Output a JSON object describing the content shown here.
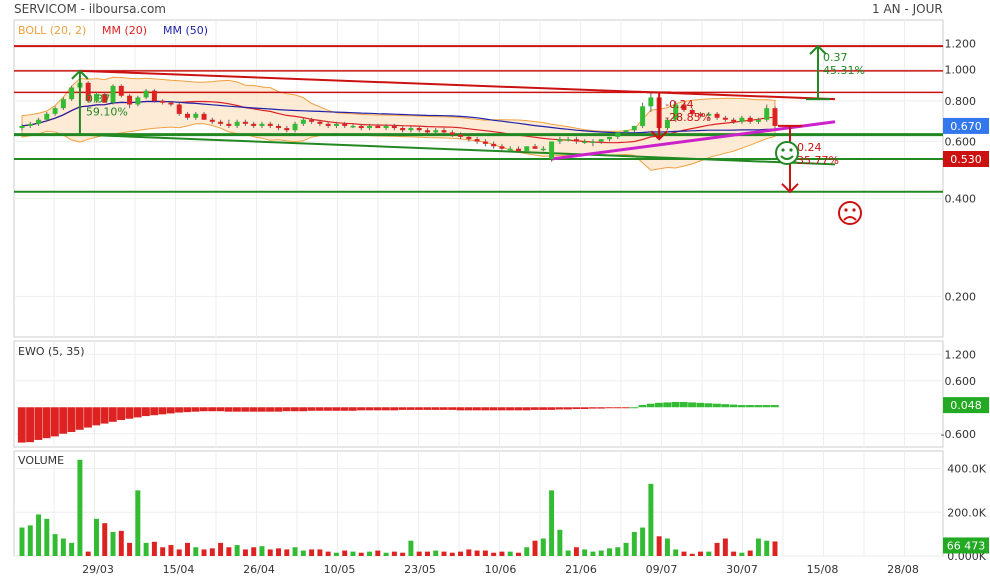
{
  "header": {
    "title": "SERVICOM - ilboursa.com",
    "period": "1 AN - JOUR"
  },
  "legend": {
    "boll": "BOLL (20, 2)",
    "mm20": "MM (20)",
    "mm50": "MM (50)",
    "ewo": "EWO (5, 35)",
    "volume": "VOLUME"
  },
  "colors": {
    "up": "#33bb33",
    "down": "#dd2222",
    "boll": "#f0a040",
    "mm20": "#dd2222",
    "mm50": "#2222aa",
    "trend_up": "#228822",
    "support_magenta": "#cc22cc",
    "price_tag": "#3377ee",
    "ref_tag": "#cc1111",
    "ewo_tag": "#22aa22"
  },
  "icons": {
    "happy": "smiley-happy-icon",
    "sad": "smiley-sad-icon"
  },
  "chart_data": [
    {
      "type": "candlestick",
      "title": "SERVICOM",
      "x_ticks": [
        "29/03",
        "15/04",
        "26/04",
        "10/05",
        "23/05",
        "10/06",
        "21/06",
        "09/07",
        "30/07",
        "15/08",
        "28/08"
      ],
      "y_ticks": [
        "1.200",
        "1.000",
        "0.800",
        "0.600",
        "0.400",
        "0.200"
      ],
      "y_scale": "log",
      "ylim": [
        0.15,
        1.42
      ],
      "last_price_label": "0.670",
      "ref_label": "0.530",
      "horizontal_levels": [
        1.18,
        0.99,
        0.85,
        0.63,
        0.53,
        0.42
      ],
      "annotations": [
        {
          "value": "0.37",
          "pct": "59.10%"
        },
        {
          "value": "0.37",
          "pct": "45.31%"
        },
        {
          "value": "-0.24",
          "pct": "-28.85%"
        },
        {
          "value": "-0.24",
          "pct": "-35.77%"
        }
      ],
      "ohlc": [
        [
          0.66,
          0.68,
          0.65,
          0.67
        ],
        [
          0.67,
          0.69,
          0.66,
          0.68
        ],
        [
          0.68,
          0.71,
          0.67,
          0.7
        ],
        [
          0.7,
          0.74,
          0.69,
          0.73
        ],
        [
          0.73,
          0.77,
          0.72,
          0.76
        ],
        [
          0.76,
          0.82,
          0.75,
          0.81
        ],
        [
          0.81,
          0.89,
          0.8,
          0.88
        ],
        [
          0.88,
          0.99,
          0.63,
          0.91
        ],
        [
          0.91,
          0.92,
          0.79,
          0.8
        ],
        [
          0.8,
          0.85,
          0.79,
          0.84
        ],
        [
          0.84,
          0.85,
          0.79,
          0.79
        ],
        [
          0.79,
          0.9,
          0.78,
          0.89
        ],
        [
          0.89,
          0.9,
          0.82,
          0.83
        ],
        [
          0.83,
          0.84,
          0.76,
          0.78
        ],
        [
          0.78,
          0.83,
          0.77,
          0.82
        ],
        [
          0.82,
          0.87,
          0.81,
          0.86
        ],
        [
          0.86,
          0.87,
          0.79,
          0.8
        ],
        [
          0.8,
          0.81,
          0.78,
          0.79
        ],
        [
          0.79,
          0.8,
          0.77,
          0.78
        ],
        [
          0.78,
          0.79,
          0.72,
          0.73
        ],
        [
          0.73,
          0.74,
          0.7,
          0.71
        ],
        [
          0.71,
          0.74,
          0.7,
          0.73
        ],
        [
          0.73,
          0.74,
          0.7,
          0.7
        ],
        [
          0.7,
          0.71,
          0.68,
          0.69
        ],
        [
          0.69,
          0.7,
          0.67,
          0.68
        ],
        [
          0.68,
          0.7,
          0.66,
          0.67
        ],
        [
          0.67,
          0.7,
          0.66,
          0.69
        ],
        [
          0.69,
          0.7,
          0.67,
          0.68
        ],
        [
          0.68,
          0.69,
          0.66,
          0.67
        ],
        [
          0.67,
          0.69,
          0.66,
          0.68
        ],
        [
          0.68,
          0.69,
          0.66,
          0.67
        ],
        [
          0.67,
          0.68,
          0.65,
          0.66
        ],
        [
          0.66,
          0.67,
          0.64,
          0.65
        ],
        [
          0.65,
          0.69,
          0.64,
          0.68
        ],
        [
          0.68,
          0.71,
          0.67,
          0.7
        ],
        [
          0.7,
          0.71,
          0.68,
          0.69
        ],
        [
          0.69,
          0.7,
          0.67,
          0.68
        ],
        [
          0.68,
          0.69,
          0.66,
          0.67
        ],
        [
          0.67,
          0.69,
          0.66,
          0.68
        ],
        [
          0.68,
          0.69,
          0.66,
          0.67
        ],
        [
          0.67,
          0.68,
          0.66,
          0.67
        ],
        [
          0.67,
          0.68,
          0.65,
          0.66
        ],
        [
          0.66,
          0.68,
          0.65,
          0.67
        ],
        [
          0.67,
          0.68,
          0.66,
          0.66
        ],
        [
          0.66,
          0.68,
          0.65,
          0.67
        ],
        [
          0.67,
          0.68,
          0.65,
          0.66
        ],
        [
          0.66,
          0.67,
          0.64,
          0.65
        ],
        [
          0.65,
          0.67,
          0.64,
          0.66
        ],
        [
          0.66,
          0.67,
          0.64,
          0.65
        ],
        [
          0.65,
          0.66,
          0.63,
          0.64
        ],
        [
          0.64,
          0.66,
          0.63,
          0.65
        ],
        [
          0.65,
          0.66,
          0.63,
          0.64
        ],
        [
          0.64,
          0.65,
          0.62,
          0.63
        ],
        [
          0.63,
          0.64,
          0.61,
          0.62
        ],
        [
          0.62,
          0.63,
          0.6,
          0.61
        ],
        [
          0.61,
          0.62,
          0.59,
          0.6
        ],
        [
          0.6,
          0.61,
          0.58,
          0.59
        ],
        [
          0.59,
          0.6,
          0.57,
          0.58
        ],
        [
          0.58,
          0.59,
          0.56,
          0.57
        ],
        [
          0.57,
          0.58,
          0.56,
          0.57
        ],
        [
          0.57,
          0.58,
          0.56,
          0.56
        ],
        [
          0.56,
          0.58,
          0.56,
          0.58
        ],
        [
          0.58,
          0.59,
          0.57,
          0.57
        ],
        [
          0.57,
          0.58,
          0.56,
          0.57
        ],
        [
          0.53,
          0.6,
          0.52,
          0.6
        ],
        [
          0.6,
          0.62,
          0.59,
          0.61
        ],
        [
          0.61,
          0.62,
          0.6,
          0.61
        ],
        [
          0.61,
          0.62,
          0.59,
          0.6
        ],
        [
          0.6,
          0.61,
          0.59,
          0.6
        ],
        [
          0.6,
          0.61,
          0.58,
          0.6
        ],
        [
          0.6,
          0.61,
          0.59,
          0.61
        ],
        [
          0.61,
          0.62,
          0.6,
          0.62
        ],
        [
          0.62,
          0.64,
          0.61,
          0.64
        ],
        [
          0.64,
          0.65,
          0.63,
          0.65
        ],
        [
          0.65,
          0.67,
          0.64,
          0.67
        ],
        [
          0.67,
          0.79,
          0.66,
          0.77
        ],
        [
          0.77,
          0.85,
          0.74,
          0.82
        ],
        [
          0.82,
          0.83,
          0.61,
          0.66
        ],
        [
          0.66,
          0.71,
          0.65,
          0.7
        ],
        [
          0.7,
          0.8,
          0.69,
          0.78
        ],
        [
          0.78,
          0.79,
          0.74,
          0.75
        ],
        [
          0.75,
          0.76,
          0.72,
          0.73
        ],
        [
          0.73,
          0.74,
          0.71,
          0.72
        ],
        [
          0.72,
          0.74,
          0.7,
          0.73
        ],
        [
          0.73,
          0.74,
          0.7,
          0.71
        ],
        [
          0.71,
          0.72,
          0.69,
          0.7
        ],
        [
          0.7,
          0.71,
          0.68,
          0.69
        ],
        [
          0.69,
          0.72,
          0.68,
          0.71
        ],
        [
          0.71,
          0.72,
          0.68,
          0.69
        ],
        [
          0.69,
          0.71,
          0.68,
          0.7
        ],
        [
          0.7,
          0.78,
          0.69,
          0.76
        ],
        [
          0.76,
          0.77,
          0.66,
          0.67
        ]
      ]
    },
    {
      "type": "bar",
      "title": "EWO (5, 35)",
      "y_ticks": [
        "1.200",
        "0.600",
        "-0.600"
      ],
      "ylim": [
        -0.9,
        1.5
      ],
      "last_value_label": "0.048",
      "values": [
        -0.8,
        -0.79,
        -0.74,
        -0.7,
        -0.66,
        -0.6,
        -0.56,
        -0.51,
        -0.46,
        -0.41,
        -0.37,
        -0.33,
        -0.29,
        -0.26,
        -0.23,
        -0.2,
        -0.18,
        -0.16,
        -0.14,
        -0.12,
        -0.11,
        -0.1,
        -0.09,
        -0.09,
        -0.09,
        -0.1,
        -0.1,
        -0.1,
        -0.1,
        -0.1,
        -0.1,
        -0.1,
        -0.09,
        -0.09,
        -0.09,
        -0.08,
        -0.08,
        -0.08,
        -0.08,
        -0.08,
        -0.08,
        -0.07,
        -0.07,
        -0.07,
        -0.07,
        -0.07,
        -0.06,
        -0.06,
        -0.06,
        -0.06,
        -0.06,
        -0.06,
        -0.06,
        -0.07,
        -0.07,
        -0.07,
        -0.07,
        -0.07,
        -0.07,
        -0.07,
        -0.07,
        -0.07,
        -0.06,
        -0.06,
        -0.06,
        -0.05,
        -0.05,
        -0.04,
        -0.04,
        -0.03,
        -0.03,
        -0.02,
        -0.02,
        -0.01,
        0.0,
        0.05,
        0.08,
        0.1,
        0.11,
        0.12,
        0.12,
        0.11,
        0.1,
        0.09,
        0.08,
        0.07,
        0.06,
        0.05,
        0.05,
        0.05,
        0.05,
        0.05
      ]
    },
    {
      "type": "bar",
      "title": "VOLUME",
      "y_ticks": [
        "400.0K",
        "200.0K",
        "0.000K"
      ],
      "ylim": [
        0,
        480000
      ],
      "last_value_label": "66 473",
      "values": [
        130000,
        140000,
        190000,
        170000,
        100000,
        80000,
        60000,
        440000,
        20000,
        170000,
        150000,
        110000,
        115000,
        60000,
        300000,
        60000,
        65000,
        40000,
        50000,
        30000,
        60000,
        40000,
        30000,
        35000,
        60000,
        40000,
        50000,
        30000,
        40000,
        45000,
        30000,
        35000,
        30000,
        40000,
        25000,
        30000,
        30000,
        20000,
        15000,
        25000,
        20000,
        15000,
        20000,
        25000,
        15000,
        20000,
        15000,
        70000,
        20000,
        20000,
        25000,
        20000,
        15000,
        20000,
        30000,
        25000,
        25000,
        15000,
        20000,
        20000,
        15000,
        40000,
        70000,
        80000,
        300000,
        120000,
        25000,
        40000,
        30000,
        20000,
        25000,
        35000,
        40000,
        60000,
        110000,
        130000,
        330000,
        90000,
        80000,
        30000,
        20000,
        10000,
        20000,
        20000,
        60000,
        80000,
        20000,
        15000,
        25000,
        80000,
        70000,
        66473
      ]
    }
  ]
}
